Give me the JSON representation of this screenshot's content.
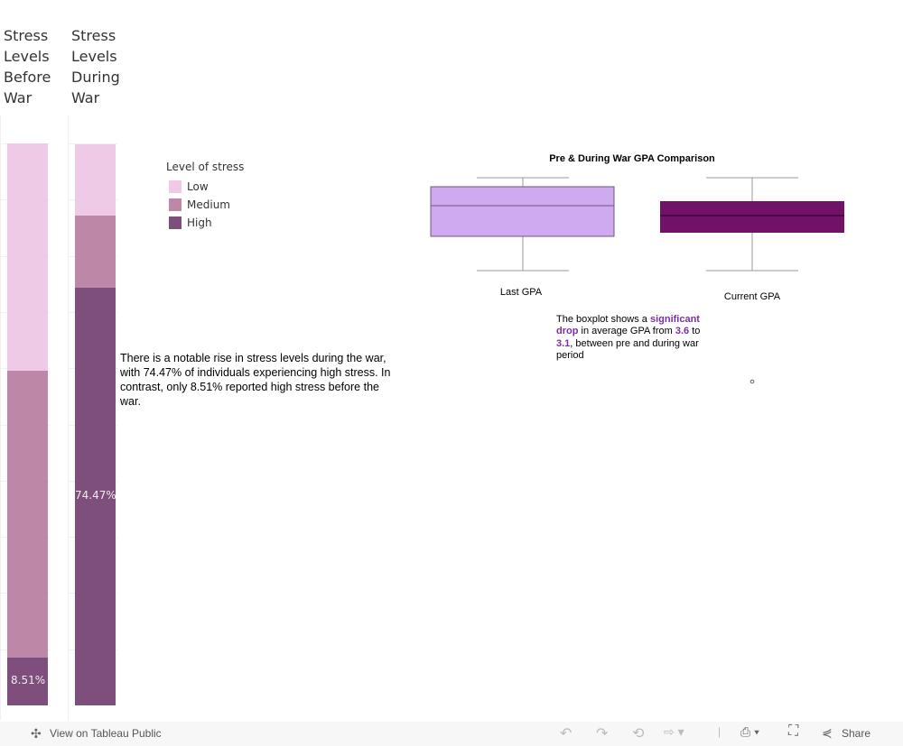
{
  "columns": [
    {
      "header": "Stress Levels Before War"
    },
    {
      "header": "Stress Levels During War"
    }
  ],
  "chart_data": [
    {
      "type": "bar",
      "stacked": true,
      "categories": [
        "Stress Levels Before War",
        "Stress Levels During War"
      ],
      "series": [
        {
          "name": "Low",
          "values": [
            40.43,
            12.77
          ],
          "color": "#eecae6"
        },
        {
          "name": "Medium",
          "values": [
            51.06,
            12.77
          ],
          "color": "#bd87a7"
        },
        {
          "name": "High",
          "values": [
            8.51,
            74.47
          ],
          "color": "#7e4e7c"
        }
      ],
      "data_labels": [
        "8.51%",
        "74.47%"
      ],
      "ylim": [
        0,
        100
      ],
      "grid": true
    },
    {
      "type": "boxplot",
      "title": "Pre & During War GPA Comparison",
      "categories": [
        "Last GPA",
        "Current GPA"
      ],
      "colors": [
        "#cfaaf1",
        "#711268"
      ]
    }
  ],
  "legend": {
    "title": "Level of stress",
    "items": [
      "Low",
      "Medium",
      "High"
    ]
  },
  "stress_note": "There is a notable rise in stress levels during the war, with 74.47% of individuals experiencing high stress. In contrast, only 8.51% reported high stress before the war.",
  "gpa_note": {
    "p1": "The boxplot shows a ",
    "h1": "significant drop",
    "p2": " in average GPA from ",
    "h2": "3.6",
    "p3": " to ",
    "h3": "3.1",
    "p4": ", between pre and during war period"
  },
  "footer": {
    "view_label": "View on Tableau Public",
    "share_label": "Share"
  }
}
